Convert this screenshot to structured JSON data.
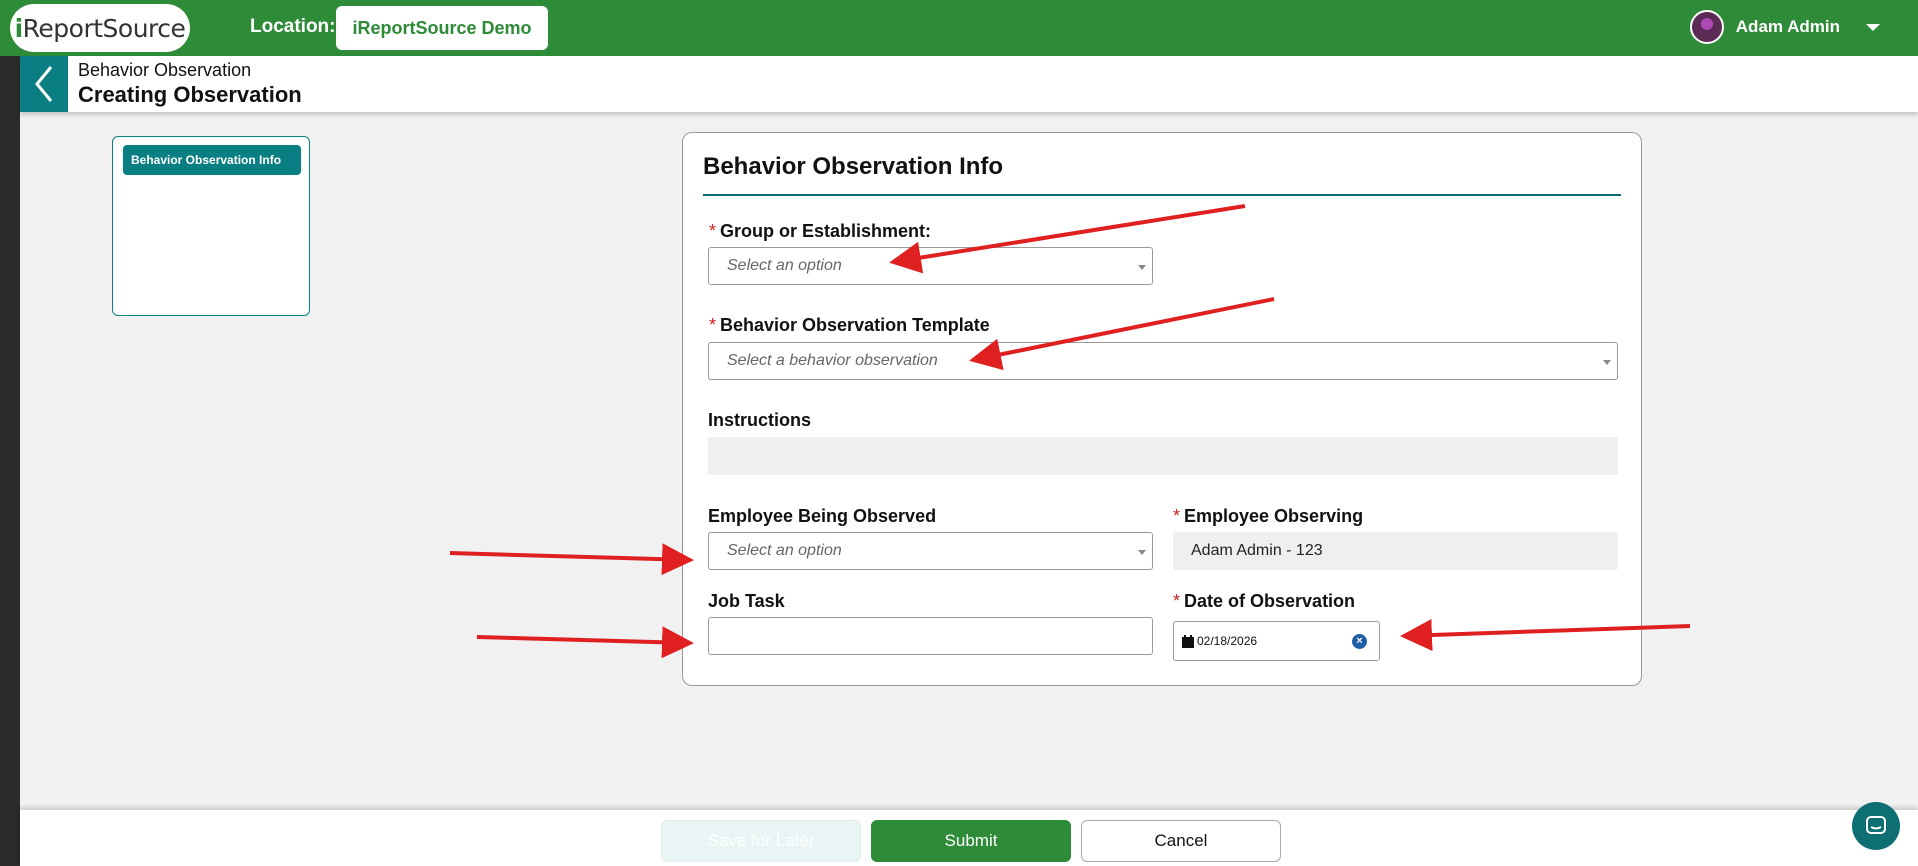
{
  "topbar": {
    "logo_prefix": "i",
    "logo_main": "Report",
    "logo_suffix": "Source",
    "location_label": "Location:",
    "location_value": "iReportSource Demo",
    "user_name": "Adam Admin"
  },
  "header": {
    "subtitle": "Behavior Observation",
    "title": "Creating Observation"
  },
  "nav": {
    "items": [
      {
        "label": "Behavior Observation Info"
      }
    ]
  },
  "form": {
    "section_title": "Behavior Observation Info",
    "group": {
      "required": "*",
      "label": "Group or Establishment:",
      "placeholder": "Select an option"
    },
    "template": {
      "required": "*",
      "label": "Behavior Observation Template",
      "placeholder": "Select a behavior observation"
    },
    "instructions": {
      "label": "Instructions",
      "value": ""
    },
    "employee_observed": {
      "label": "Employee Being Observed",
      "placeholder": "Select an option"
    },
    "employee_observing": {
      "required": "*",
      "label": "Employee Observing",
      "value": "Adam Admin - 123"
    },
    "job_task": {
      "label": "Job Task",
      "value": ""
    },
    "date": {
      "required": "*",
      "label": "Date of Observation",
      "value": "02/18/2026"
    }
  },
  "footer": {
    "save_label": "Save for Later",
    "submit_label": "Submit",
    "cancel_label": "Cancel"
  },
  "colors": {
    "brand_green": "#2e8b37",
    "teal": "#0a7f83",
    "annotation_red": "#e02020"
  }
}
